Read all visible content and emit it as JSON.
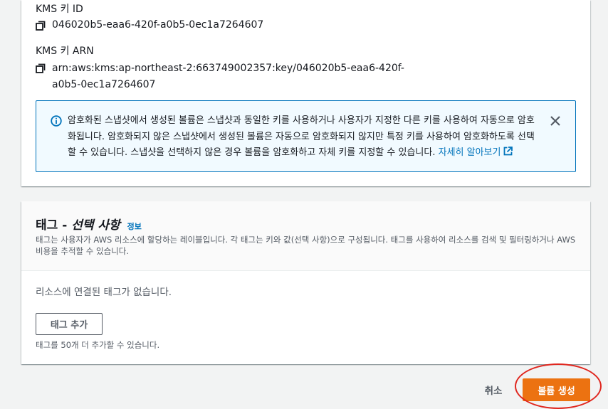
{
  "kms": {
    "key_id_label": "KMS 키 ID",
    "key_id_value": "046020b5-eaa6-420f-a0b5-0ec1a7264607",
    "key_arn_label": "KMS 키 ARN",
    "key_arn_value": "arn:aws:kms:ap-northeast-2:663749002357:key/046020b5-eaa6-420f-a0b5-0ec1a7264607"
  },
  "alert": {
    "text": "암호화된 스냅샷에서 생성된 볼륨은 스냅샷과 동일한 키를 사용하거나 사용자가 지정한 다른 키를 사용하여 자동으로 암호화됩니다. 암호화되지 않은 스냅샷에서 생성된 볼륨은 자동으로 암호화되지 않지만 특정 키를 사용하여 암호화하도록 선택할 수 있습니다. 스냅샷을 선택하지 않은 경우 볼륨을 암호화하고 자체 키를 지정할 수 있습니다.",
    "link": "자세히 알아보기",
    "icon": "info-circle-icon",
    "accent_color": "#0073bb"
  },
  "tags": {
    "title_prefix": "태그 - ",
    "title_optional": "선택 사항",
    "info_link": "정보",
    "description": "태그는 사용자가 AWS 리소스에 할당하는 레이블입니다. 각 태그는 키와 값(선택 사항)으로 구성됩니다. 태그를 사용하여 리소스를 검색 및 필터링하거나 AWS 비용을 추적할 수 있습니다.",
    "empty_text": "리소스에 연결된 태그가 없습니다.",
    "add_button": "태그 추가",
    "hint": "태그를 50개 더 추가할 수 있습니다."
  },
  "footer": {
    "cancel": "취소",
    "create": "볼륨 생성",
    "primary_color": "#ec7211",
    "highlight_color": "#e0271f"
  }
}
